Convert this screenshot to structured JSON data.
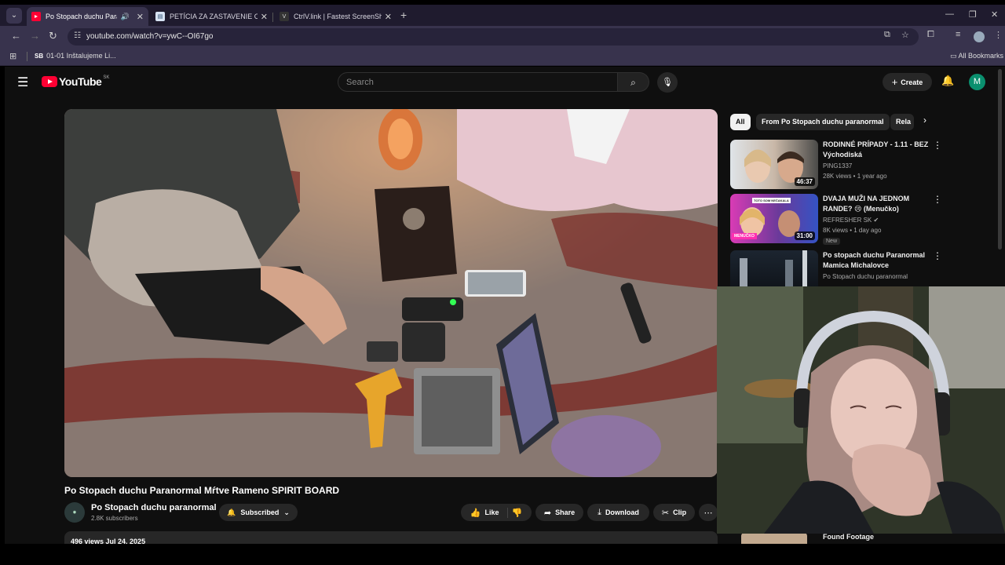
{
  "tabs": [
    {
      "title": "Po Stopach duchu Paranormal",
      "active": true
    },
    {
      "title": "PETÍCIA ZA ZASTAVENIE OBNOVY",
      "active": false
    },
    {
      "title": "CtrlV.link | Fastest ScreenShot and",
      "active": false
    }
  ],
  "address_bar": {
    "url": "youtube.com/watch?v=ywC--OI67go"
  },
  "bookmarks": {
    "item": "01-01 Inštalujeme Li...",
    "item_badge": "SB",
    "all": "All Bookmarks"
  },
  "youtube": {
    "logo_text": "YouTube",
    "country_code": "SK",
    "search_placeholder": "Search",
    "create_label": "Create",
    "avatar_letter": "M",
    "video": {
      "title": "Po Stopach duchu Paranormal Mŕtve Rameno SPIRIT BOARD",
      "channel": "Po Stopach duchu paranormal",
      "subscribers": "2.8K subscribers",
      "subscribed_label": "Subscribed",
      "like_label": "Like",
      "share_label": "Share",
      "download_label": "Download",
      "clip_label": "Clip",
      "views_date": "496 views  Jul 24, 2025"
    },
    "chips": [
      "All",
      "From Po Stopach duchu paranormal",
      "Rela"
    ],
    "recommendations": [
      {
        "title": "RODINNÉ PRÍPADY - 1.11 - BEZ Východiská",
        "channel": "PING1337",
        "meta": "28K views • 1 year ago",
        "duration": "46:37"
      },
      {
        "title": "DVAJA MUŽI NA JEDNOM RANDE? 😢 (Menučko)",
        "channel": "REFRESHER SK ✔",
        "meta": "8K views • 1 day ago",
        "duration": "31:00",
        "badge": "New",
        "thumb_text_1": "TOTO SOM NEČAKALA",
        "thumb_text_2": "MENUČKO"
      },
      {
        "title": "Po stopach duchu Paranormal Mamica Michalovce",
        "channel": "Po Stopach duchu paranormal",
        "meta": "",
        "duration": ""
      }
    ],
    "last_rec_title": "Found Footage"
  },
  "colors": {
    "accent_red": "#ff0033",
    "avatar_green": "#0a8f6e",
    "chrome_bg": "#38334d"
  }
}
